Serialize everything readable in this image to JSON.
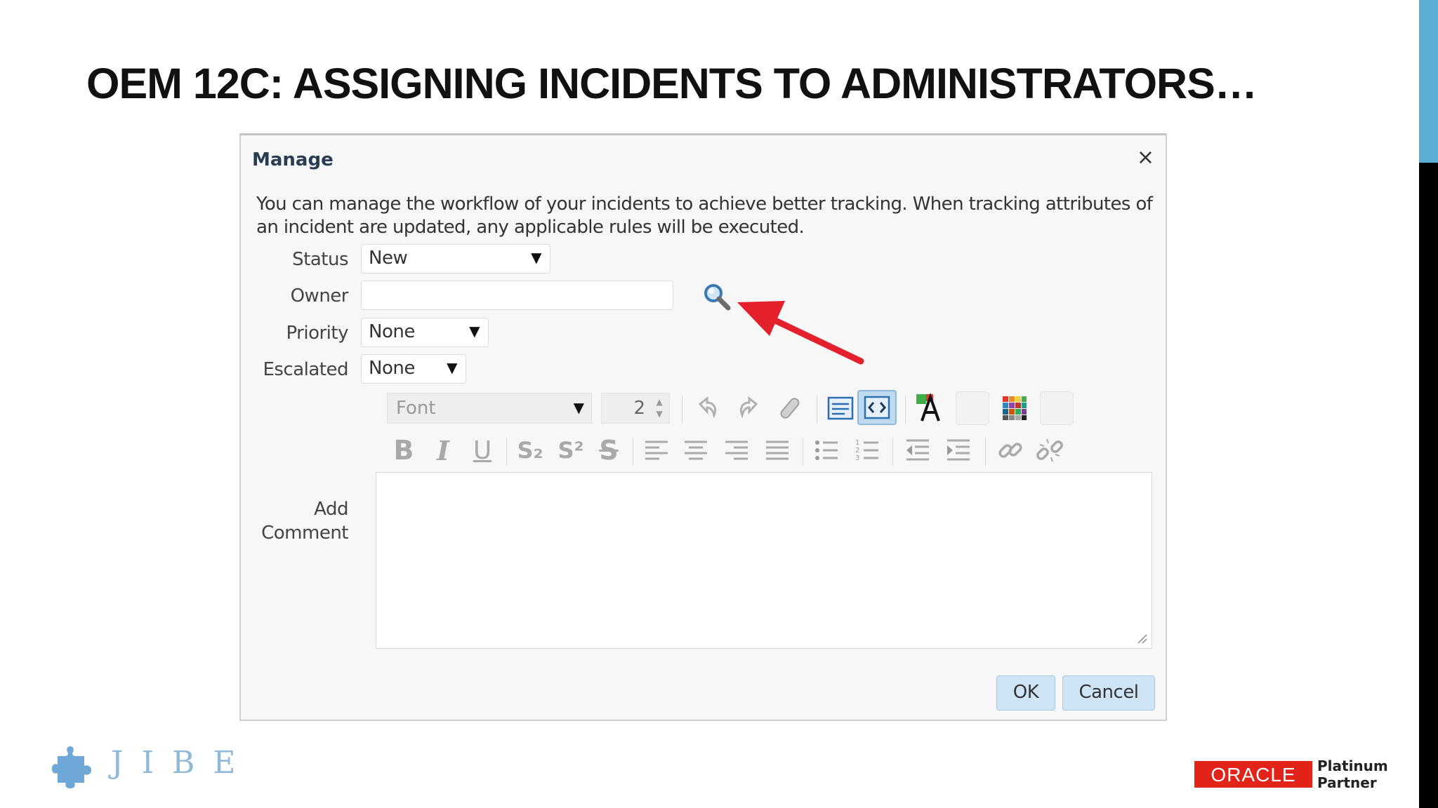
{
  "slide": {
    "title": "OEM 12C: ASSIGNING INCIDENTS TO ADMINISTRATORS…"
  },
  "dialog": {
    "title": "Manage",
    "close_glyph": "×",
    "description": "You can manage the workflow of your incidents to achieve better tracking. When tracking attributes of an incident are updated, any applicable rules will be executed.",
    "fields": {
      "status": {
        "label": "Status",
        "value": "New"
      },
      "owner": {
        "label": "Owner",
        "value": ""
      },
      "priority": {
        "label": "Priority",
        "value": "None"
      },
      "escalated": {
        "label": "Escalated",
        "value": "None"
      }
    },
    "editor": {
      "font_select": "Font",
      "font_size": "2",
      "comment_label_line1": "Add",
      "comment_label_line2": "Comment",
      "toolbar_glyphs": {
        "bold": "B",
        "italic": "I",
        "underline": "U",
        "subscript": "S₂",
        "superscript": "S²",
        "strikethrough": "S"
      },
      "comment_value": ""
    },
    "buttons": {
      "ok": "OK",
      "cancel": "Cancel"
    },
    "dropdown_glyph": "▼"
  },
  "branding": {
    "jibe": "JIBE",
    "oracle": "ORACLE",
    "partner_line1": "Platinum",
    "partner_line2": "Partner"
  },
  "colors": {
    "accent_blue": "#5aaed4",
    "arrow_red": "#e3202c",
    "oracle_red": "#e2231a",
    "button_blue": "#cfe4f5"
  }
}
